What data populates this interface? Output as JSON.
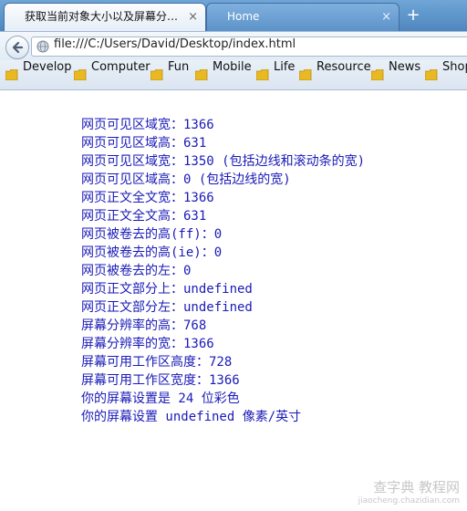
{
  "tabs": [
    {
      "title": "获取当前对象大小以及屏幕分…",
      "close": "×"
    },
    {
      "title": "Home",
      "close": "×"
    }
  ],
  "new_tab": "+",
  "address_bar": {
    "url": "file:///C:/Users/David/Desktop/index.html"
  },
  "bookmarks": [
    "Develop",
    "Computer",
    "Fun",
    "Mobile",
    "Life",
    "Resource",
    "News",
    "Shop"
  ],
  "content": {
    "lines": [
      "网页可见区域宽：1366",
      "网页可见区域高：631",
      "网页可见区域宽：1350 (包括边线和滚动条的宽)",
      "网页可见区域高：0 (包括边线的宽)",
      "网页正文全文宽：1366",
      "网页正文全文高：631",
      "网页被卷去的高(ff)：0",
      "网页被卷去的高(ie)：0",
      "网页被卷去的左：0",
      "网页正文部分上：undefined",
      "网页正文部分左：undefined",
      "屏幕分辨率的高：768",
      "屏幕分辨率的宽：1366",
      "屏幕可用工作区高度：728",
      "屏幕可用工作区宽度：1366",
      "你的屏幕设置是 24 位彩色",
      "你的屏幕设置 undefined 像素/英寸"
    ]
  },
  "watermark": {
    "main": "查字典 教程网",
    "sub": "jiaocheng.chazidian.com"
  },
  "colors": {
    "text": "#1a1ab8",
    "tab_strip": "#5b92c8",
    "folder": "#e8b923"
  }
}
